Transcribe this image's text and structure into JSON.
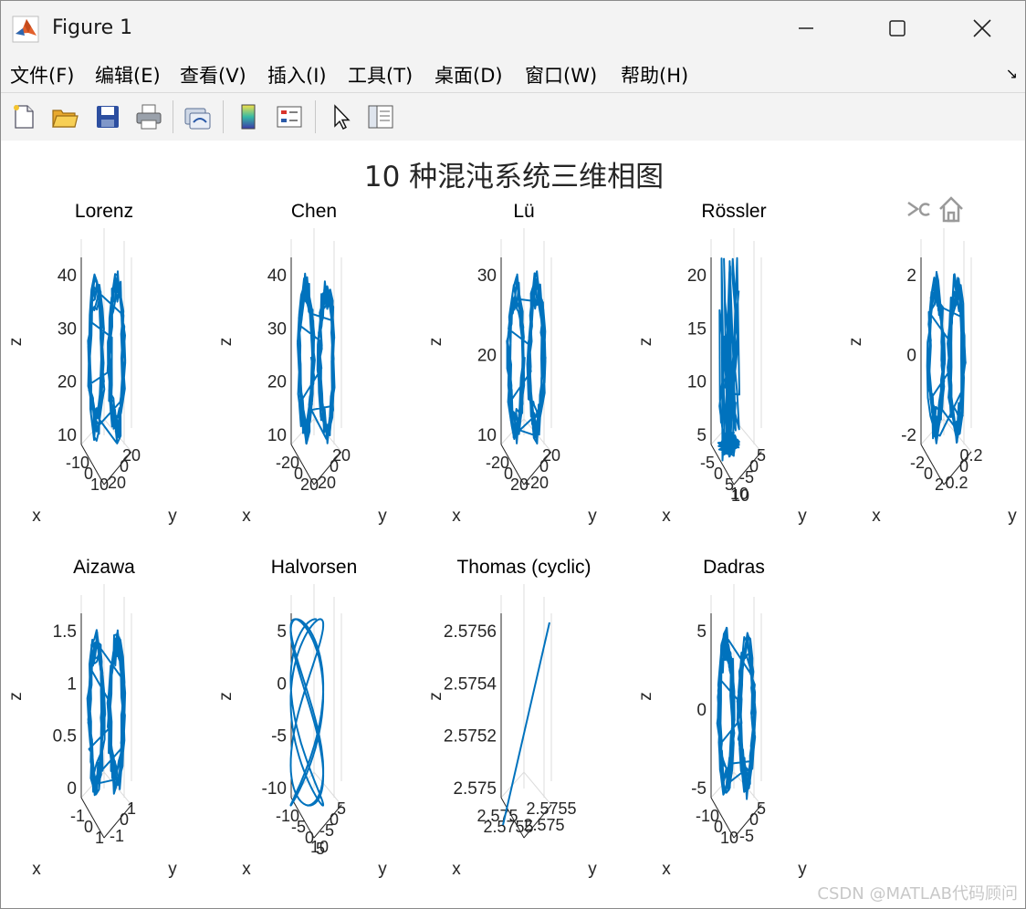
{
  "window": {
    "title": "Figure 1"
  },
  "menu": [
    "文件(F)",
    "编辑(E)",
    "查看(V)",
    "插入(I)",
    "工具(T)",
    "桌面(D)",
    "窗口(W)",
    "帮助(H)"
  ],
  "toolbar": {
    "icons": [
      "new-figure-icon",
      "open-file-icon",
      "save-icon",
      "print-icon",
      "link-plot-icon",
      "colorbar-icon",
      "legend-icon",
      "pointer-icon",
      "property-inspector-icon"
    ]
  },
  "figure": {
    "title": "10 种混沌系统三维相图",
    "line_color": "#0072BD",
    "watermark": "CSDN @MATLAB代码顾问",
    "subplots": [
      {
        "title": "Lorenz",
        "zticks": [
          "40",
          "30",
          "20",
          "10"
        ],
        "xticks": [
          "-10",
          "0",
          "10"
        ],
        "yticks": [
          "20",
          "0",
          "20"
        ],
        "xlabel": "x",
        "ylabel": "y",
        "zlabel": "z"
      },
      {
        "title": "Chen",
        "zticks": [
          "40",
          "30",
          "20",
          "10"
        ],
        "xticks": [
          "-20",
          "0",
          "20"
        ],
        "yticks": [
          "20",
          "0",
          "20"
        ],
        "xlabel": "x",
        "ylabel": "y",
        "zlabel": "z"
      },
      {
        "title": "Lü",
        "zticks": [
          "30",
          "20",
          "10"
        ],
        "xticks": [
          "-20",
          "0",
          "20"
        ],
        "yticks": [
          "20",
          "0",
          "-20"
        ],
        "xlabel": "x",
        "ylabel": "y",
        "zlabel": "z"
      },
      {
        "title": "Rössler",
        "zticks": [
          "20",
          "15",
          "10",
          "5"
        ],
        "xticks": [
          "-5",
          "0",
          "5",
          "10"
        ],
        "yticks": [
          "5",
          "0",
          "-5",
          "10"
        ],
        "xlabel": "x",
        "ylabel": "y",
        "zlabel": "z"
      },
      {
        "title": "",
        "zticks": [
          "2",
          "0",
          "-2"
        ],
        "xticks": [
          "-2",
          "0",
          "2"
        ],
        "yticks": [
          "0.2",
          "0",
          "0.2"
        ],
        "xlabel": "x",
        "ylabel": "y",
        "zlabel": "z"
      },
      {
        "title": "Aizawa",
        "zticks": [
          "1.5",
          "1",
          "0.5",
          "0"
        ],
        "xticks": [
          "-1",
          "0",
          "1"
        ],
        "yticks": [
          "1",
          "0",
          "-1"
        ],
        "xlabel": "x",
        "ylabel": "y",
        "zlabel": "z"
      },
      {
        "title": "Halvorsen",
        "zticks": [
          "5",
          "0",
          "-5",
          "-10"
        ],
        "xticks": [
          "-10",
          "-5",
          "0",
          "5"
        ],
        "yticks": [
          "5",
          "0",
          "-5",
          "10"
        ],
        "xlabel": "x",
        "ylabel": "y",
        "zlabel": "z"
      },
      {
        "title": "Thomas (cyclic)",
        "zticks": [
          "2.5756",
          "2.5754",
          "2.5752",
          "2.575"
        ],
        "xticks": [
          "2.575",
          "2.5755"
        ],
        "yticks": [
          "2.5755",
          "2.575"
        ],
        "xlabel": "x",
        "ylabel": "y",
        "zlabel": "z"
      },
      {
        "title": "Dadras",
        "zticks": [
          "5",
          "0",
          "-5"
        ],
        "xticks": [
          "-10",
          "0",
          "10"
        ],
        "yticks": [
          "5",
          "0",
          "-5"
        ],
        "xlabel": "x",
        "ylabel": "y",
        "zlabel": "z"
      }
    ]
  }
}
